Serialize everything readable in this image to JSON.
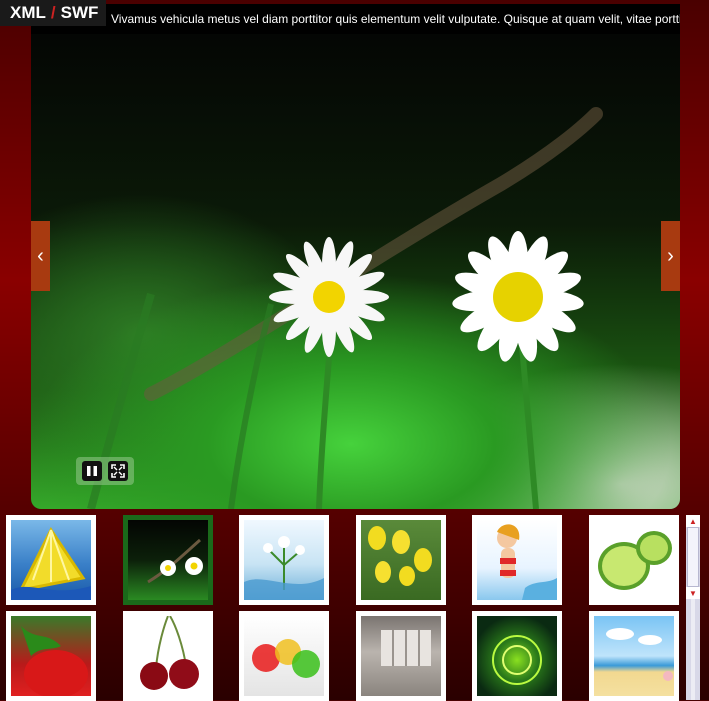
{
  "header": {
    "xml_label": "XML",
    "separator": "/",
    "swf_label": "SWF"
  },
  "viewer": {
    "caption": "Vivamus vehicula metus vel diam porttitor quis elementum velit vulputate. Quisque at quam velit, vitae porttitor diam.",
    "prev_icon": "chevron-left-icon",
    "prev_glyph": "‹",
    "next_icon": "chevron-right-icon",
    "next_glyph": "›",
    "pause_icon": "pause-icon",
    "fullscreen_icon": "fullscreen-icon"
  },
  "thumbnails": [
    {
      "name": "lemon-slice",
      "active": false
    },
    {
      "name": "daisies",
      "active": true
    },
    {
      "name": "white-lilies-water",
      "active": false
    },
    {
      "name": "yellow-tulips",
      "active": false
    },
    {
      "name": "beach-girl",
      "active": false
    },
    {
      "name": "lime-halves",
      "active": false
    },
    {
      "name": "strawberry",
      "active": false
    },
    {
      "name": "cherries",
      "active": false
    },
    {
      "name": "glass-apples",
      "active": false
    },
    {
      "name": "interior-room",
      "active": false
    },
    {
      "name": "green-fractal",
      "active": false
    },
    {
      "name": "beach-cartoon",
      "active": false
    }
  ],
  "colors": {
    "accent_red": "#cc2222",
    "nav_button": "#a83a10",
    "active_thumb_border": "#1a6a1a"
  }
}
